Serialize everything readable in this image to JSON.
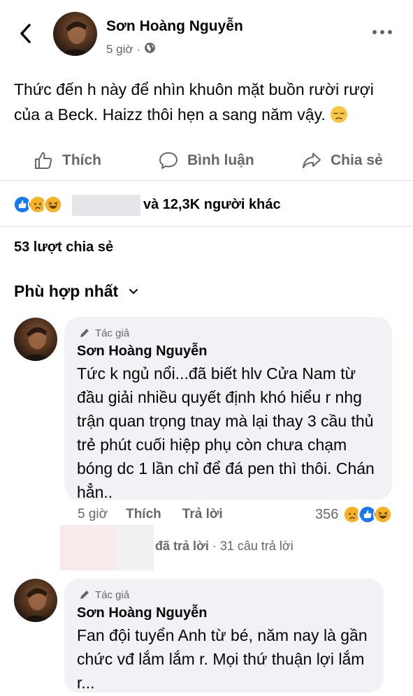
{
  "post": {
    "author": "Sơn Hoàng Nguyễn",
    "time": "5 giờ",
    "separator": "·",
    "text": "Thức đến h này để nhìn khuôn mặt buồn rười rượi của a Beck. Haizz thôi hẹn a sang năm vậy.",
    "emoji": "pensive-face"
  },
  "actions": {
    "like": "Thích",
    "comment": "Bình luận",
    "share": "Chia sẻ"
  },
  "reactions": {
    "icons": [
      "like",
      "sad",
      "haha"
    ],
    "summary": "và 12,3K người khác"
  },
  "shares": "53 lượt chia sẻ",
  "sort": {
    "label": "Phù hợp nhất"
  },
  "comments": [
    {
      "badge": "Tác giả",
      "author": "Sơn Hoàng Nguyễn",
      "text": "Tức k ngủ nổi...đã biết hlv Cửa Nam từ đầu giải nhiều quyết định khó hiểu r nhg trận quan trọng tnay mà lại thay 3 cầu thủ trẻ phút cuối hiệp phụ còn chưa chạm bóng dc 1 lần chỉ để đá pen thì thôi. Chán hẳn..",
      "time": "5 giờ",
      "like": "Thích",
      "reply": "Trả lời",
      "reaction_count": "356",
      "reaction_icons": [
        "sad",
        "like",
        "haha"
      ],
      "replies_text": "đã trả lời",
      "replies_separator": "·",
      "replies_count": "31 câu trả lời"
    },
    {
      "badge": "Tác giả",
      "author": "Sơn Hoàng Nguyễn",
      "text": "Fan đội tuyển Anh từ bé, năm nay là gần chức vđ lắm lắm r. Mọi thứ thuận lợi lắm r..."
    }
  ],
  "colors": {
    "like_blue": "#1877f2",
    "reaction_yellow": "#f7b125",
    "muted_text": "#65676b",
    "bubble_bg": "#f0f2f5"
  }
}
